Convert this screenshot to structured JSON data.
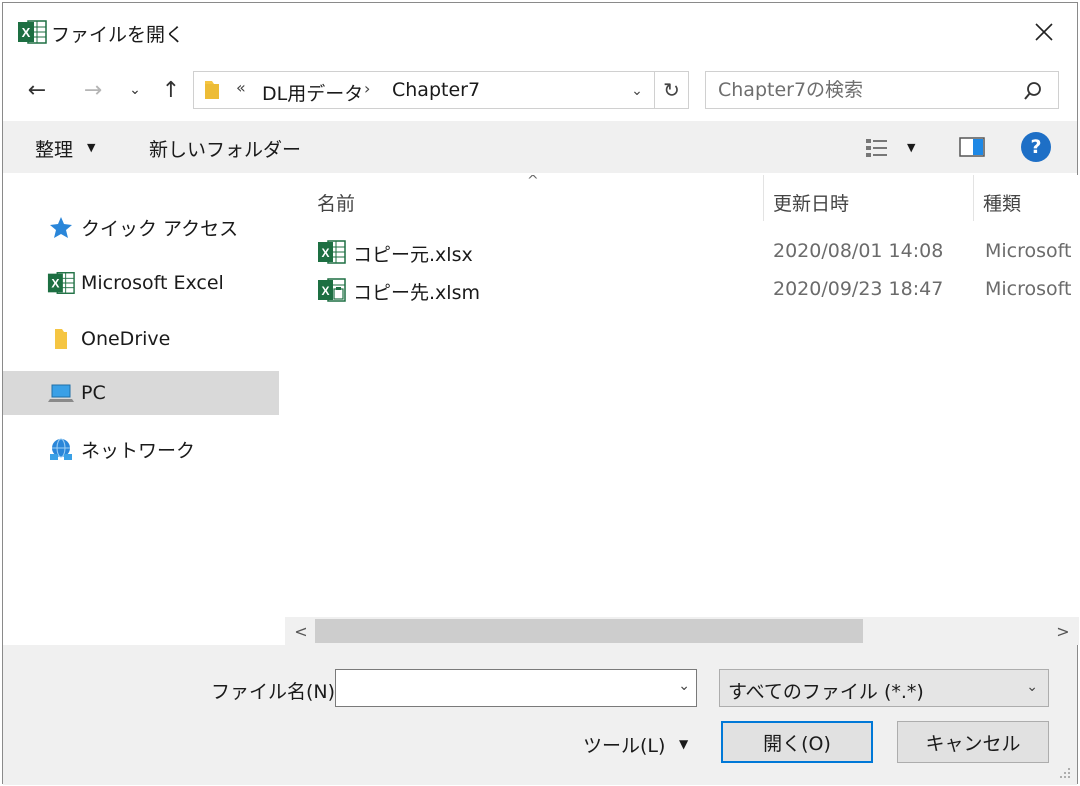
{
  "window": {
    "title": "ファイルを開く",
    "app_icon": "excel-icon",
    "close_icon": "close-icon"
  },
  "address": {
    "overflow": "«",
    "segments": [
      "DL用データ",
      "Chapter7"
    ],
    "separator": "›",
    "folder_icon": "folder-icon"
  },
  "nav_buttons": {
    "back": "←",
    "forward": "→",
    "recent": "⌄",
    "up": "↑",
    "refresh": "↻",
    "dropdown": "⌄"
  },
  "search": {
    "placeholder": "Chapter7の検索",
    "icon": "search-icon"
  },
  "toolbar": {
    "organize_label": "整理",
    "new_folder_label": "新しいフォルダー",
    "arrow": "▼",
    "help_label": "?"
  },
  "sidebar": {
    "items": [
      {
        "label": "クイック アクセス",
        "icon": "quick-access-star-icon",
        "selected": false
      },
      {
        "label": "Microsoft Excel",
        "icon": "excel-icon",
        "selected": false
      },
      {
        "label": "OneDrive",
        "icon": "onedrive-folder-icon",
        "selected": false
      },
      {
        "label": "PC",
        "icon": "pc-icon",
        "selected": true
      },
      {
        "label": "ネットワーク",
        "icon": "network-icon",
        "selected": false
      }
    ]
  },
  "file_list": {
    "sort_caret": "^",
    "columns": {
      "name": "名前",
      "date": "更新日時",
      "type": "種類"
    },
    "files": [
      {
        "name": "コピー元.xlsx",
        "date": "2020/08/01 14:08",
        "type": "Microsoft",
        "icon": "xlsx-file-icon"
      },
      {
        "name": "コピー先.xlsm",
        "date": "2020/09/23 18:47",
        "type": "Microsoft",
        "icon": "xlsm-file-icon"
      }
    ]
  },
  "scrollbar": {
    "left": "<",
    "right": ">"
  },
  "bottom": {
    "filename_label": "ファイル名(N):",
    "filename_value": "",
    "filetype_value": "すべてのファイル (*.*)",
    "dropdown": "⌄",
    "tools_label": "ツール(L)",
    "tools_arrow": "▼",
    "open_label": "開く(O)",
    "cancel_label": "キャンセル"
  },
  "colors": {
    "excel_green": "#1d6f42",
    "accent_blue": "#0078d7",
    "help_blue": "#1e6fc6",
    "folder_yellow": "#f5c542",
    "selection_gray": "#d9d9d9"
  }
}
